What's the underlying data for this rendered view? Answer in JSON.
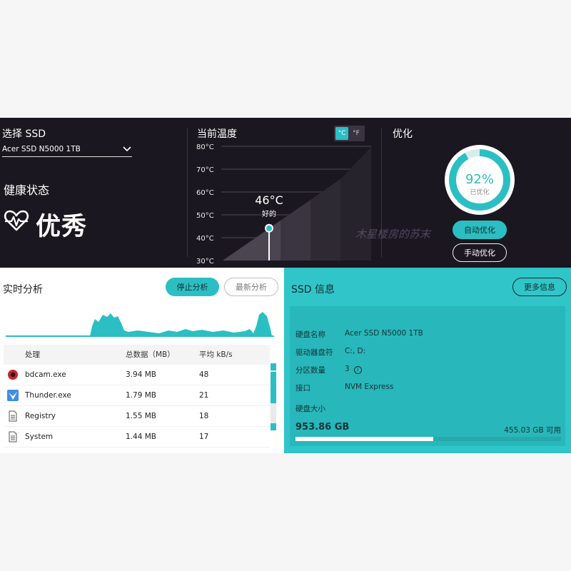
{
  "select_ssd": {
    "title": "选择 SSD",
    "selected": "Acer SSD N5000 1TB"
  },
  "health": {
    "title": "健康状态",
    "value": "优秀"
  },
  "temperature": {
    "title": "当前温度",
    "unit_c": "°C",
    "unit_f": "°F",
    "axis_labels": [
      "80°C",
      "70°C",
      "60°C",
      "50°C",
      "40°C",
      "30°C"
    ],
    "current": "46°C",
    "current_value": 46,
    "status": "好的"
  },
  "optimize": {
    "title": "优化",
    "percent_label": "92%",
    "percent": 92,
    "status": "已优化",
    "auto_button": "自动优化",
    "manual_button": "手动优化"
  },
  "watermark": "木星楼房的苏末",
  "realtime": {
    "title": "实时分析",
    "stop_button": "停止分析",
    "latest_button": "最新分析",
    "columns": [
      "处理",
      "总数据（MB）",
      "平均 kB/s"
    ],
    "rows": [
      {
        "icon": "record-icon",
        "name": "bdcam.exe",
        "total": "3.94 MB",
        "avg": "48"
      },
      {
        "icon": "thunder-bird-icon",
        "name": "Thunder.exe",
        "total": "1.79 MB",
        "avg": "21"
      },
      {
        "icon": "document-icon",
        "name": "Registry",
        "total": "1.55 MB",
        "avg": "18"
      },
      {
        "icon": "document-icon",
        "name": "System",
        "total": "1.44 MB",
        "avg": "17"
      }
    ]
  },
  "ssd_info": {
    "title": "SSD 信息",
    "more_button": "更多信息",
    "fields": [
      {
        "label": "硬盘名称",
        "value": "Acer SSD N5000 1TB"
      },
      {
        "label": "驱动器盘符",
        "value": "C:, D:"
      },
      {
        "label": "分区数量",
        "value": "3"
      },
      {
        "label": "接口",
        "value": "NVM Express"
      }
    ],
    "size_label": "硬盘大小",
    "size_total": "953.86 GB",
    "size_free": "455.03 GB 可用",
    "used_fraction": 0.52
  },
  "colors": {
    "accent": "#2bbfc3",
    "dark_bg": "#1b1720",
    "info_bg": "#2fc5c9"
  }
}
